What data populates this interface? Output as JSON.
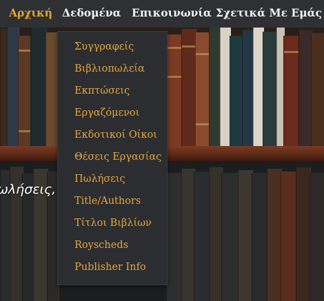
{
  "nav": {
    "items": [
      {
        "label": "Αρχική",
        "active": true
      },
      {
        "label": "Δεδομένα",
        "active": false
      },
      {
        "label": "Επικοινωνία",
        "active": false
      },
      {
        "label": "Σχετικά Με Εμάς",
        "active": false
      }
    ]
  },
  "dropdown": {
    "items": [
      "Συγγραφείς",
      "Βιβλιοπωλεία",
      "Εκπτώσεις",
      "Εργαζόμενοι",
      "Εκδοτικοί Οίκοι",
      "Θέσεις Εργασίας",
      "Πωλήσεις",
      "Title/Authors",
      "Τίτλοι Βιβλίων",
      "Royscheds",
      "Publisher Info"
    ]
  },
  "hero": {
    "partial_text": "ωλήσεις,"
  },
  "colors": {
    "navbar_bg": "#2e3034",
    "active_nav": "#e4a72a",
    "dropdown_bg": "#2b2d31",
    "dropdown_text": "#e7a73a"
  }
}
